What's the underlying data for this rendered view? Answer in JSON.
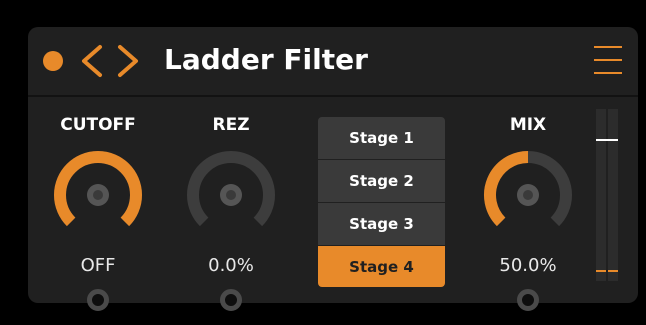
{
  "colors": {
    "accent": "#e88a2a",
    "track": "#3d3d3d",
    "knob_center": "#555555"
  },
  "header": {
    "title": "Ladder Filter",
    "status_dot_icon": "orange-circle",
    "prev_icon": "chevron-left-icon",
    "next_icon": "chevron-right-icon",
    "menu_icon": "hamburger-menu-icon"
  },
  "knobs": [
    {
      "id": "cutoff",
      "label": "CUTOFF",
      "value_text": "OFF",
      "level": 1.0
    },
    {
      "id": "rez",
      "label": "REZ",
      "value_text": "0.0%",
      "level": 0.0
    },
    {
      "id": "mix",
      "label": "MIX",
      "value_text": "50.0%",
      "level": 0.5
    }
  ],
  "stages": {
    "options": [
      "Stage 1",
      "Stage 2",
      "Stage 3",
      "Stage 4"
    ],
    "selected": "Stage 4"
  },
  "meter": {
    "peak_level": 0.82,
    "left_level": 0.13,
    "right_level": 0.13
  }
}
